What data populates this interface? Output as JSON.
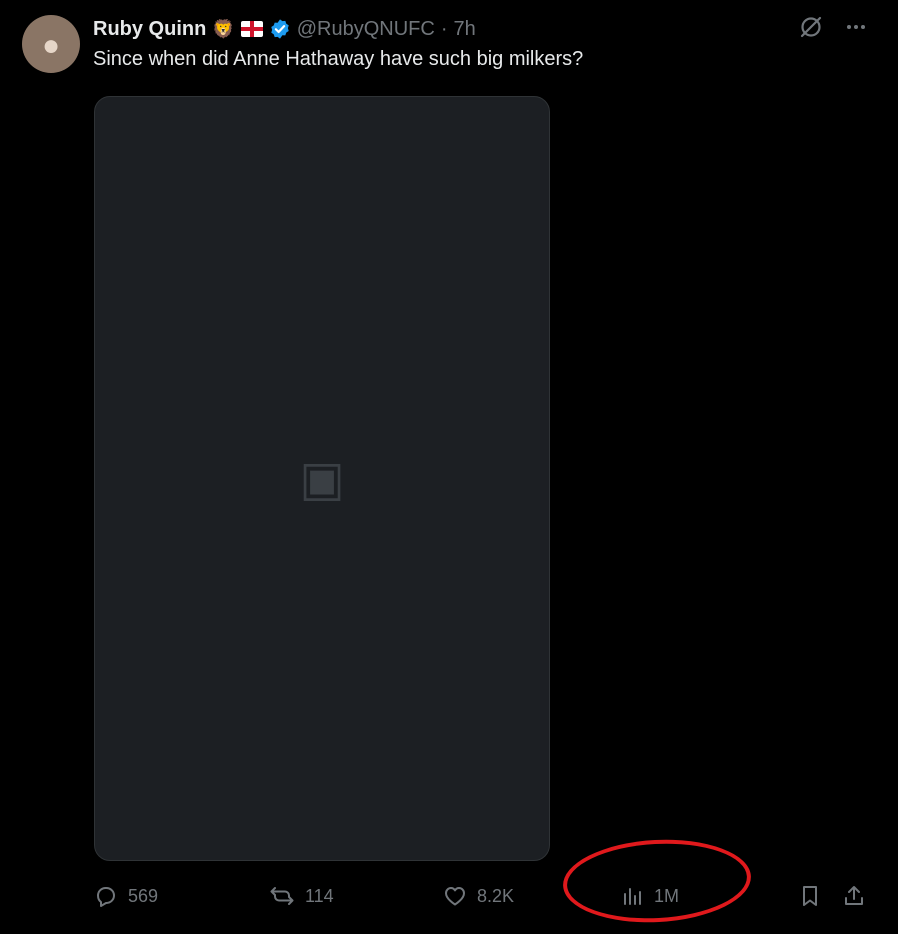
{
  "author": {
    "display_name": "Ruby Quinn",
    "handle": "@RubyQNUFC",
    "separator": "·",
    "timestamp": "7h",
    "badges": [
      "lion-emoji",
      "england-flag",
      "verified-badge"
    ]
  },
  "post": {
    "text": "Since when did Anne Hathaway have such big milkers?"
  },
  "media": {
    "kind": "photo"
  },
  "actions": {
    "replies": "569",
    "reposts": "114",
    "likes": "8.2K",
    "views": "1M"
  },
  "annotation": {
    "highlight": "views-count",
    "color": "#e0191c"
  },
  "colors": {
    "background": "#000000",
    "primary_text": "#e7e9ea",
    "secondary_text": "#71767b",
    "verified_blue": "#1d9bf0"
  }
}
